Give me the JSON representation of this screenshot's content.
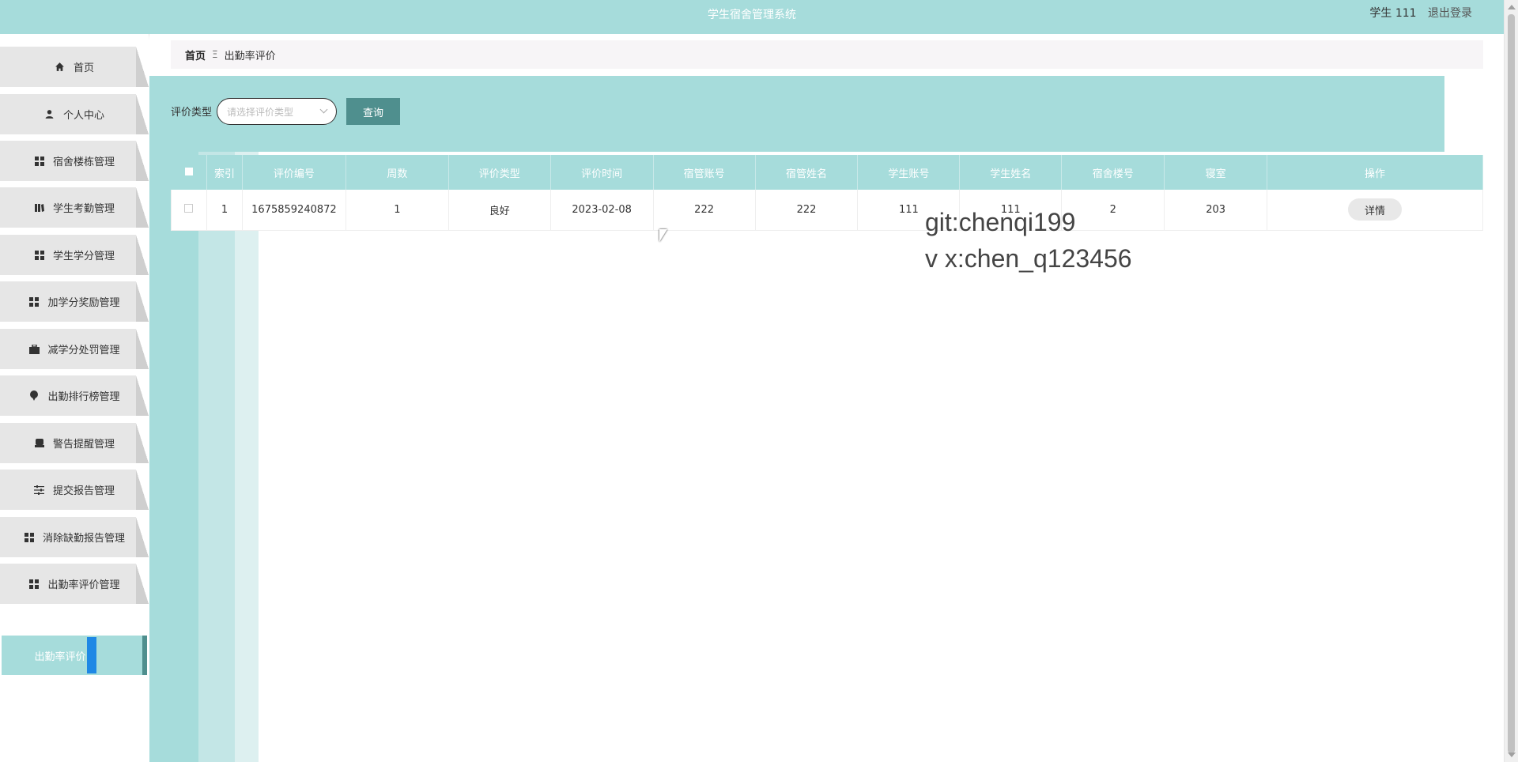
{
  "topbar": {
    "title": "学生宿舍管理系统",
    "user_label": "学生 111",
    "logout_label": "退出登录"
  },
  "sidebar": {
    "items": [
      {
        "label": "首页",
        "icon": "home-icon"
      },
      {
        "label": "个人中心",
        "icon": "user-icon"
      },
      {
        "label": "宿舍楼栋管理",
        "icon": "grid-icon"
      },
      {
        "label": "学生考勤管理",
        "icon": "book-icon"
      },
      {
        "label": "学生学分管理",
        "icon": "grid-icon"
      },
      {
        "label": "加学分奖励管理",
        "icon": "grid-icon"
      },
      {
        "label": "减学分处罚管理",
        "icon": "briefcase-icon"
      },
      {
        "label": "出勤排行榜管理",
        "icon": "pin-icon"
      },
      {
        "label": "警告提醒管理",
        "icon": "printer-icon"
      },
      {
        "label": "提交报告管理",
        "icon": "sliders-icon"
      },
      {
        "label": "消除缺勤报告管理",
        "icon": "grid-icon"
      },
      {
        "label": "出勤率评价管理",
        "icon": "grid-icon"
      }
    ],
    "active_sub": "出勤率评价"
  },
  "breadcrumb": {
    "home": "首页",
    "sep": "Ξ",
    "current": "出勤率评价"
  },
  "search": {
    "label": "评价类型",
    "placeholder": "请选择评价类型",
    "button": "查询"
  },
  "table": {
    "headers": [
      "索引",
      "评价编号",
      "周数",
      "评价类型",
      "评价时间",
      "宿管账号",
      "宿管姓名",
      "学生账号",
      "学生姓名",
      "宿舍楼号",
      "寝室",
      "操作"
    ],
    "rows": [
      {
        "index": "1",
        "code": "1675859240872",
        "week": "1",
        "type": "良好",
        "time": "2023-02-08",
        "manager_account": "222",
        "manager_name": "222",
        "student_account": "111",
        "student_name": "111",
        "building": "2",
        "room": "203",
        "action": "详情"
      }
    ]
  },
  "watermark": {
    "line1": "git:chenqi199",
    "line2": "v x:chen_q123456"
  }
}
